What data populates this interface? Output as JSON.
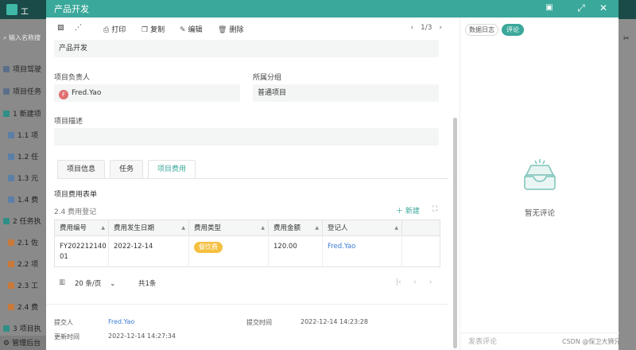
{
  "background": {
    "app_title": "工",
    "search_placeholder": "输入名称搜",
    "items": [
      {
        "label": "项目驾驶",
        "color": "#5b6f8a"
      },
      {
        "label": "项目任务",
        "color": "#5b6f8a"
      },
      {
        "label": "1 新建项",
        "color": "#2f8f86"
      },
      {
        "label": "1.1 项",
        "color": "#5b7fa8"
      },
      {
        "label": "1.2 任",
        "color": "#5b7fa8"
      },
      {
        "label": "1.3 元",
        "color": "#5b7fa8"
      },
      {
        "label": "1.4 费",
        "color": "#5b7fa8"
      },
      {
        "label": "2 任务执",
        "color": "#2f8f86"
      },
      {
        "label": "2.1 佐",
        "color": "#c97a3a"
      },
      {
        "label": "2.2 项",
        "color": "#c97a3a"
      },
      {
        "label": "2.3 工",
        "color": "#c97a3a"
      },
      {
        "label": "2.4 费",
        "color": "#c97a3a"
      },
      {
        "label": "3 项目执",
        "color": "#2f8f86"
      },
      {
        "label": "管理后台",
        "color": "#333333"
      }
    ]
  },
  "modal": {
    "title": "产品开发",
    "header_icons": [
      "book-icon",
      "expand-icon",
      "close-icon"
    ],
    "toolbar": {
      "print": "打印",
      "copy": "复制",
      "edit": "编辑",
      "delete": "删除",
      "pager": "1/3"
    },
    "form": {
      "project_name_value": "产品开发",
      "owner_label": "项目负责人",
      "owner_initial": "F",
      "owner_value": "Fred.Yao",
      "group_label": "所属分组",
      "group_value": "普通项目",
      "desc_label": "项目描述",
      "desc_value": ""
    },
    "tabs": [
      "项目信息",
      "任务",
      "项目费用"
    ],
    "active_tab": "项目费用",
    "section_title": "项目费用表单",
    "sub_title": "2.4 费用登记",
    "new_button": "新建",
    "table": {
      "headers": [
        "费用编号",
        "费用发生日期",
        "费用类型",
        "费用金额",
        "登记人"
      ],
      "rows": [
        {
          "id_line1": "FY202212140",
          "id_line2": "01",
          "date": "2022-12-14",
          "type": "餐饮费",
          "amount": "120.00",
          "registrant": "Fred.Yao"
        }
      ]
    },
    "pagination": {
      "page_size": "20 条/页",
      "total": "共1条"
    },
    "footer": {
      "submitter_label": "提交人",
      "submitter_value": "Fred.Yao",
      "submit_time_label": "提交时间",
      "submit_time_value": "2022-12-14 14:23:28",
      "update_time_label": "更新时间",
      "update_time_value": "2022-12-14 14:27:34"
    },
    "right_panel": {
      "tab_log": "数据日志",
      "tab_comment": "评论",
      "empty_text": "暂无评论",
      "comment_placeholder": "发表评论"
    }
  },
  "watermark": "CSDN @保卫大狮兄",
  "colors": {
    "accent": "#3aa89a",
    "badge": "#f5c041",
    "link": "#3a7bd5"
  }
}
